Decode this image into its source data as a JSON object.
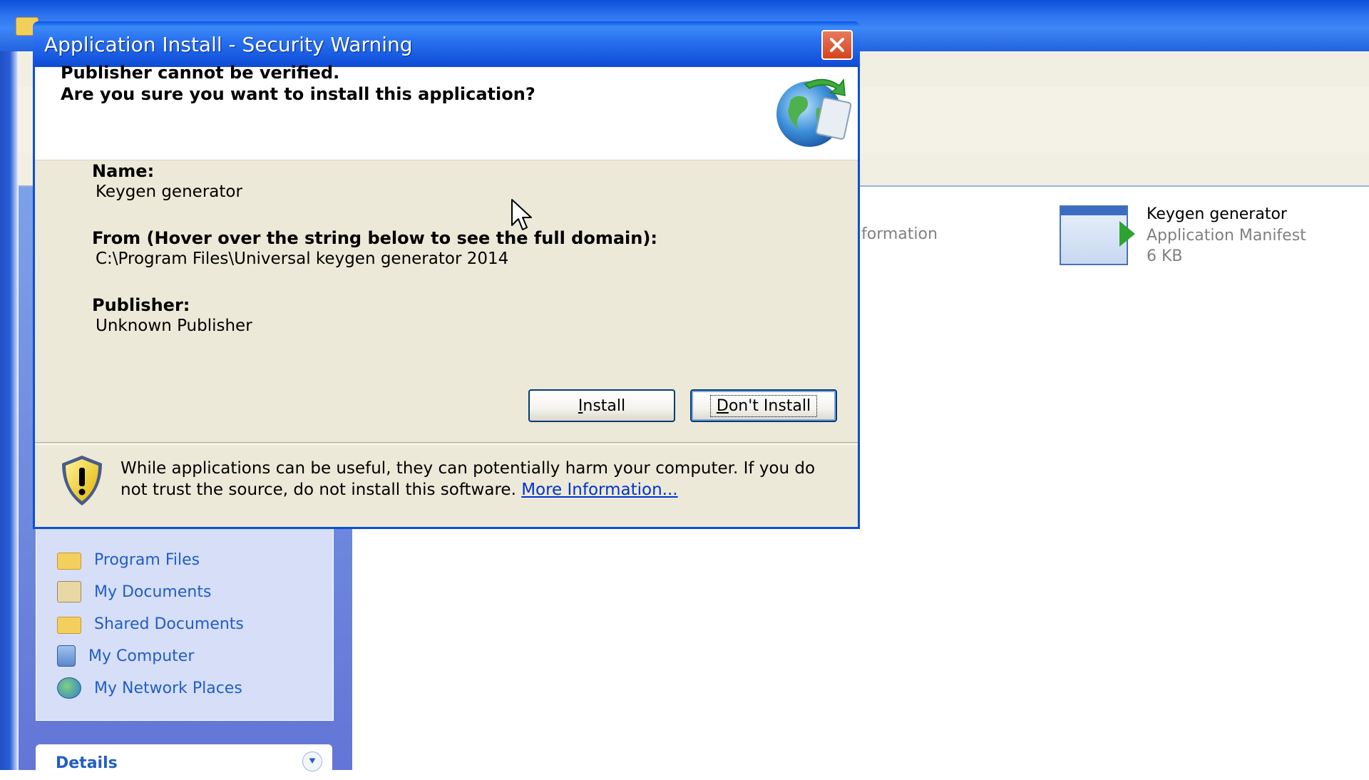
{
  "dialog": {
    "title": "Application Install - Security Warning",
    "header_line1": "Publisher cannot be verified.",
    "header_line2": "Are you sure you want to install this application?",
    "name_label": "Name:",
    "name_value": "Keygen generator",
    "from_label": "From (Hover over the string below to see the full domain):",
    "from_value": "C:\\Program Files\\Universal keygen generator 2014",
    "publisher_label": "Publisher:",
    "publisher_value": "Unknown Publisher",
    "install_button": {
      "accel": "I",
      "rest": "nstall"
    },
    "dont_install_button": {
      "accel": "D",
      "rest": "on't Install"
    },
    "warning_text": "While applications can be useful, they can potentially harm your computer. If you do not trust the source, do not install this software.",
    "more_info_link": "More Information..."
  },
  "explorer": {
    "partial_info_text": "formation",
    "file": {
      "name": "Keygen generator",
      "type": "Application Manifest",
      "size": "6 KB"
    },
    "other_places": [
      {
        "label": "Program Files",
        "icon": "folder-icon"
      },
      {
        "label": "My Documents",
        "icon": "documents-icon"
      },
      {
        "label": "Shared Documents",
        "icon": "folder-icon"
      },
      {
        "label": "My Computer",
        "icon": "computer-icon"
      },
      {
        "label": "My Network Places",
        "icon": "network-icon"
      }
    ],
    "details_title": "Details"
  },
  "colors": {
    "titlebar_blue": "#0a55e8",
    "dialog_face": "#ece9d8",
    "link_blue": "#0033cc",
    "taskpane_link": "#215dc6",
    "close_red": "#d6421c"
  }
}
